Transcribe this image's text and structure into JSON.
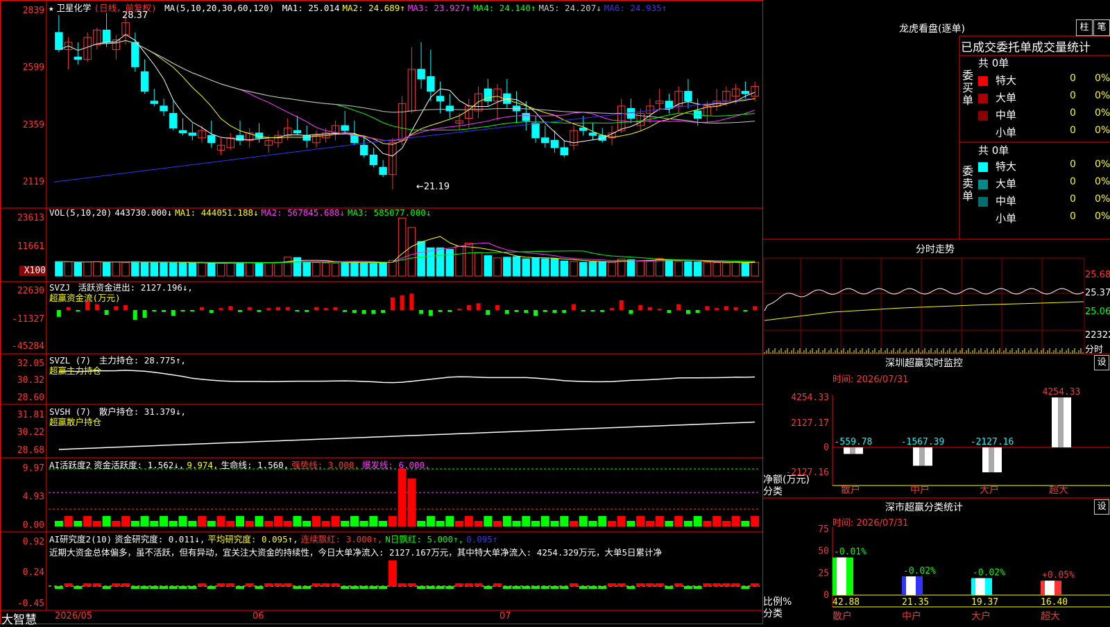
{
  "header": {
    "star": "★",
    "stock_name": "卫星化学",
    "mode": "(日线，前复权)",
    "ma_label": "MA(5,10,20,30,60,120)",
    "ma_items": [
      {
        "label": "MA1: 25.014",
        "color": "#ffffff"
      },
      {
        "label": "MA2: 24.689↑",
        "color": "#ffff00"
      },
      {
        "label": "MA3: 23.927↑",
        "color": "#ff33ff"
      },
      {
        "label": "MA4: 24.140↑",
        "color": "#00ff00"
      },
      {
        "label": "MA5: 24.207↓",
        "color": "#c8c8c8"
      },
      {
        "label": "MA6: 24.935↑",
        "color": "#3333ff"
      }
    ]
  },
  "price_axis": [
    "2839",
    "2599",
    "2359",
    "2119"
  ],
  "price_annotations": {
    "high": "28.37",
    "low": "←21.19"
  },
  "vol": {
    "axis": [
      "23613",
      "11661",
      "X100"
    ],
    "title": "VOL(5,10,20)",
    "items": [
      {
        "label": "443730.000↓",
        "color": "#ffffff"
      },
      {
        "label": "MA1: 444051.188↓",
        "color": "#ffff00"
      },
      {
        "label": "MA2: 567845.688↓",
        "color": "#ff33ff"
      },
      {
        "label": "MA3: 585077.000↓",
        "color": "#00ff00"
      }
    ]
  },
  "svzj": {
    "axis": [
      "22630",
      "-11327",
      "-45284"
    ],
    "title": "SVZJ",
    "line1": "活跃资金进出: 2127.196↓,",
    "line2": "超赢资金流(万元)"
  },
  "svzl": {
    "axis": [
      "32.05",
      "30.32",
      "28.60"
    ],
    "title": "SVZL (7)",
    "line1": "主力持仓: 28.775↑,",
    "line2": "超赢主力持仓"
  },
  "svsh": {
    "axis": [
      "31.81",
      "30.22",
      "28.68"
    ],
    "title": "SVSH (7)",
    "line1": "散户持仓: 31.379↓,",
    "line2": "超赢散户持仓"
  },
  "ai1": {
    "axis": [
      "9.97",
      "4.93",
      "0.00"
    ],
    "title": "AI活跃度2",
    "items": [
      {
        "label": "资金活跃度: 1.562↓,",
        "color": "#ffffff"
      },
      {
        "label": "9.974,",
        "color": "#ffff00"
      },
      {
        "label": "生命线: 1.560,",
        "color": "#ffffff"
      },
      {
        "label": "强势线: 3.000,",
        "color": "#ff3333"
      },
      {
        "label": "爆发线: 6.000,",
        "color": "#ff33ff"
      }
    ]
  },
  "ai2": {
    "axis": [
      "0.92",
      "0.24",
      "-0.45"
    ],
    "title": "AI研究度2(10)",
    "items": [
      {
        "label": "资金研究度: 0.011↓,",
        "color": "#ffffff"
      },
      {
        "label": "平均研究度: 0.095↑,",
        "color": "#ffff00"
      },
      {
        "label": "连续飘红: 3.000↑,",
        "color": "#ff3333"
      },
      {
        "label": "N日飘红: 5.000↑,",
        "color": "#00ff00"
      },
      {
        "label": "0.095↑",
        "color": "#3333ff"
      }
    ],
    "text": "近期大资金总体偏多，虽不活跃，但有异动，宜关注大资金的持续性，今日大单净流入: 2127.167万元，其中特大单净流入: 4254.329万元，大单5日累计净"
  },
  "xaxis": {
    "brand": "大智慧",
    "labels": [
      "2026/05",
      "06",
      "07"
    ]
  },
  "right": {
    "lhb_title": "龙虎看盘(逐单)",
    "btn1": "柱",
    "btn2": "笔",
    "stats_title": "已成交委托单成交量统计",
    "buy": {
      "side": "委买单",
      "total": "共 0单",
      "rows": [
        {
          "name": "特大",
          "val": "0",
          "pct": "0%",
          "color": "#ff0000"
        },
        {
          "name": "大单",
          "val": "0",
          "pct": "0%",
          "color": "#aa0000"
        },
        {
          "name": "中单",
          "val": "0",
          "pct": "0%",
          "color": "#880000"
        },
        {
          "name": "小单",
          "val": "0",
          "pct": "0%",
          "color": "#000000"
        }
      ]
    },
    "sell": {
      "side": "委卖单",
      "total": "共 0单",
      "rows": [
        {
          "name": "特大",
          "val": "0",
          "pct": "0%",
          "color": "#00ffff"
        },
        {
          "name": "大单",
          "val": "0",
          "pct": "0%",
          "color": "#008b8b"
        },
        {
          "name": "中单",
          "val": "0",
          "pct": "0%",
          "color": "#006f6f"
        },
        {
          "name": "小单",
          "val": "0",
          "pct": "0%",
          "color": "#000000"
        }
      ]
    },
    "intraday": {
      "title": "分时走势",
      "axis": [
        "25.68",
        "25.37",
        "25.06",
        "22322",
        "分时"
      ]
    },
    "monitor": {
      "title": "深圳超赢实时监控",
      "btn": "设",
      "time": "时间: 2026/07/31",
      "axis": [
        "4254.33",
        "2127.17",
        "0",
        "-2127.16"
      ],
      "ylabel": "净额(万元)",
      "ylabel2": "分类",
      "bars": [
        {
          "cat": "散户",
          "value": -559.78,
          "label": "-559.78"
        },
        {
          "cat": "中户",
          "value": -1567.39,
          "label": "-1567.39"
        },
        {
          "cat": "大户",
          "value": -2127.16,
          "label": "-2127.16"
        },
        {
          "cat": "超大",
          "value": 4254.33,
          "label": "4254.33"
        }
      ]
    },
    "classify": {
      "title": "深市超赢分类统计",
      "btn": "设",
      "time": "时间: 2026/07/31",
      "axis": [
        "75",
        "50",
        "25",
        "0"
      ],
      "ylabel": "比例%",
      "ylabel2": "分类",
      "bars": [
        {
          "cat": "散户",
          "value": 42.88,
          "label": "42.88",
          "change": "-0.01%",
          "color": "#00ff00"
        },
        {
          "cat": "中户",
          "value": 21.35,
          "label": "21.35",
          "change": "-0.02%",
          "color": "#3333ff"
        },
        {
          "cat": "大户",
          "value": 19.37,
          "label": "19.37",
          "change": "-0.02%",
          "color": "#00ffff"
        },
        {
          "cat": "超大",
          "value": 16.4,
          "label": "16.40",
          "change": "+0.05%",
          "color": "#ff3333"
        }
      ]
    }
  },
  "chart_data": [
    {
      "type": "candlestick",
      "title": "卫星化学 (日线，前复权)",
      "ylim": [
        21.19,
        28.37
      ],
      "ohlc": [
        [
          27.6,
          28.3,
          26.8,
          26.9
        ],
        [
          26.9,
          27.4,
          26.1,
          27.2
        ],
        [
          26.6,
          27.2,
          26.3,
          26.5
        ],
        [
          26.5,
          27.6,
          26.4,
          27.4
        ],
        [
          27.1,
          27.8,
          26.9,
          27.7
        ],
        [
          27.7,
          28.4,
          27.0,
          27.2
        ],
        [
          26.9,
          27.5,
          26.5,
          27.3
        ],
        [
          27.5,
          28.3,
          27.1,
          28.0
        ],
        [
          27.2,
          27.6,
          26.0,
          26.2
        ],
        [
          26.0,
          26.5,
          25.1,
          25.2
        ],
        [
          24.8,
          25.3,
          24.6,
          24.7
        ],
        [
          24.6,
          24.9,
          24.2,
          24.4
        ],
        [
          24.3,
          24.8,
          23.6,
          23.7
        ],
        [
          23.6,
          24.1,
          23.4,
          23.5
        ],
        [
          23.5,
          23.9,
          23.2,
          23.4
        ],
        [
          23.3,
          23.8,
          23.1,
          23.6
        ],
        [
          23.4,
          24.0,
          22.9,
          23.1
        ],
        [
          22.8,
          23.3,
          22.6,
          23.0
        ],
        [
          22.9,
          23.5,
          22.8,
          23.3
        ],
        [
          23.4,
          24.0,
          23.0,
          23.2
        ],
        [
          23.2,
          23.7,
          22.9,
          23.5
        ],
        [
          23.5,
          23.9,
          23.1,
          23.3
        ],
        [
          23.0,
          23.4,
          22.7,
          23.2
        ],
        [
          23.1,
          23.6,
          22.9,
          23.4
        ],
        [
          23.4,
          24.1,
          23.2,
          23.7
        ],
        [
          23.6,
          24.2,
          23.4,
          23.5
        ],
        [
          23.4,
          23.8,
          22.9,
          23.2
        ],
        [
          23.1,
          23.6,
          22.9,
          23.4
        ],
        [
          23.3,
          23.7,
          23.1,
          23.5
        ],
        [
          23.5,
          24.0,
          23.2,
          23.8
        ],
        [
          23.8,
          24.4,
          23.5,
          23.6
        ],
        [
          23.4,
          24.0,
          23.0,
          23.1
        ],
        [
          23.0,
          23.3,
          22.5,
          22.6
        ],
        [
          22.6,
          22.9,
          22.1,
          22.2
        ],
        [
          22.1,
          22.4,
          21.7,
          21.8
        ],
        [
          21.8,
          23.3,
          21.2,
          23.1
        ],
        [
          23.2,
          25.0,
          23.0,
          24.7
        ],
        [
          24.4,
          27.0,
          24.3,
          26.1
        ],
        [
          26.1,
          27.2,
          25.3,
          25.7
        ],
        [
          25.8,
          26.9,
          24.8,
          25.2
        ],
        [
          25.0,
          25.6,
          24.3,
          24.8
        ],
        [
          24.6,
          25.1,
          24.1,
          24.4
        ],
        [
          23.9,
          24.3,
          23.6,
          24.0
        ],
        [
          24.1,
          24.9,
          23.7,
          24.6
        ],
        [
          24.4,
          25.4,
          24.1,
          25.1
        ],
        [
          25.3,
          25.7,
          24.6,
          24.8
        ],
        [
          24.8,
          25.5,
          24.0,
          25.3
        ],
        [
          25.1,
          25.7,
          24.5,
          24.7
        ],
        [
          24.6,
          25.2,
          23.9,
          24.4
        ],
        [
          24.3,
          24.8,
          23.6,
          24.0
        ],
        [
          23.9,
          24.2,
          23.1,
          23.3
        ],
        [
          23.3,
          23.8,
          22.9,
          23.1
        ],
        [
          23.2,
          23.6,
          22.7,
          22.9
        ],
        [
          22.9,
          23.2,
          22.5,
          22.6
        ],
        [
          23.0,
          23.8,
          22.8,
          23.6
        ],
        [
          23.7,
          24.2,
          23.4,
          23.6
        ],
        [
          23.5,
          23.9,
          23.2,
          23.4
        ],
        [
          23.4,
          23.7,
          23.1,
          23.2
        ],
        [
          23.3,
          23.8,
          23.0,
          23.5
        ],
        [
          23.6,
          24.9,
          23.5,
          24.6
        ],
        [
          24.5,
          24.9,
          23.9,
          24.1
        ],
        [
          23.8,
          24.5,
          23.6,
          24.3
        ],
        [
          24.3,
          24.9,
          23.9,
          24.6
        ],
        [
          24.7,
          25.3,
          24.4,
          24.8
        ],
        [
          24.8,
          25.1,
          24.3,
          24.5
        ],
        [
          24.6,
          25.4,
          24.3,
          25.2
        ],
        [
          25.2,
          25.7,
          24.5,
          24.8
        ],
        [
          24.4,
          24.9,
          23.8,
          24.1
        ],
        [
          24.2,
          24.8,
          23.9,
          24.6
        ],
        [
          24.6,
          25.3,
          24.4,
          24.8
        ],
        [
          24.8,
          25.4,
          24.6,
          25.2
        ],
        [
          25.0,
          25.5,
          24.7,
          25.3
        ],
        [
          25.2,
          25.6,
          24.9,
          25.1
        ],
        [
          25.0,
          25.6,
          24.8,
          25.4
        ]
      ]
    },
    {
      "type": "bar",
      "title": "VOL(5,10,20)",
      "ylabel": "X100",
      "values": [
        4.6,
        4.5,
        4.4,
        4.5,
        4.6,
        4.4,
        4.5,
        4.3,
        4.6,
        4.5,
        4.4,
        4.3,
        4.2,
        4.3,
        4.1,
        4.2,
        4.0,
        4.1,
        4.2,
        4.3,
        4.2,
        4.1,
        4.3,
        4.4,
        6.0,
        5.9,
        4.5,
        4.3,
        4.2,
        4.1,
        4.4,
        4.6,
        4.2,
        4.0,
        4.1,
        5.0,
        18.5,
        15.5,
        11.0,
        9.0,
        9.0,
        8.5,
        9.5,
        10.5,
        7.5,
        6.5,
        5.8,
        6.0,
        6.2,
        5.5,
        5.8,
        5.5,
        5.5,
        4.8,
        4.6,
        4.4,
        4.5,
        4.6,
        4.4,
        5.4,
        5.2,
        4.8,
        5.0,
        5.6,
        5.2,
        4.7,
        4.6,
        4.5,
        4.4,
        4.3,
        4.2,
        4.4,
        4.3,
        4.4
      ]
    }
  ]
}
